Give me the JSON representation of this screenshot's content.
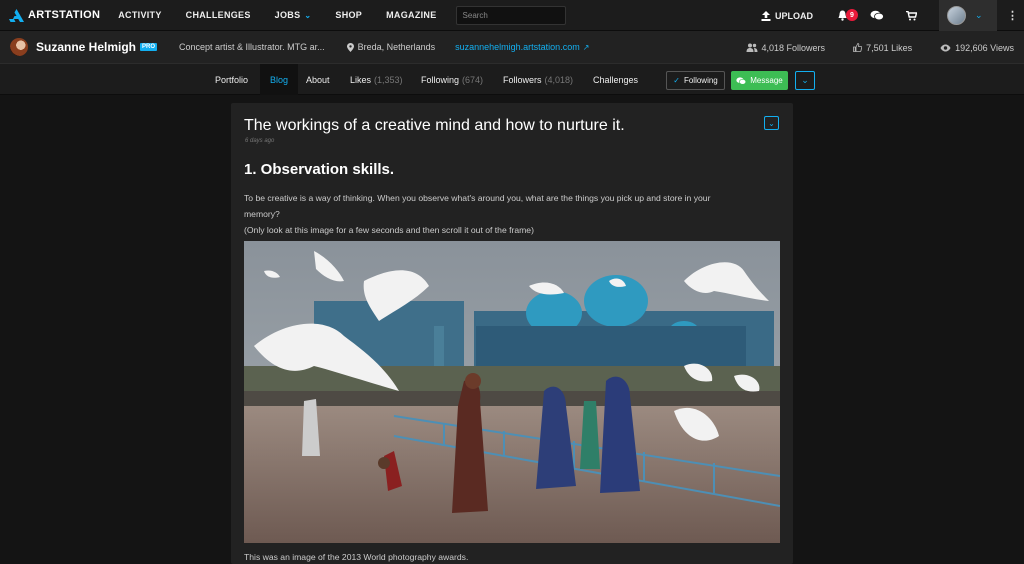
{
  "topnav": {
    "logo_text": "ARTSTATION",
    "items": [
      "ACTIVITY",
      "CHALLENGES",
      "JOBS",
      "SHOP",
      "MAGAZINE"
    ],
    "search_placeholder": "Search",
    "upload_label": "UPLOAD",
    "notification_count": "9"
  },
  "profile": {
    "name": "Suzanne Helmigh",
    "pro_badge": "PRO",
    "headline": "Concept artist & Illustrator. MTG ar...",
    "location": "Breda, Netherlands",
    "website": "suzannehelmigh.artstation.com",
    "followers": "4,018 Followers",
    "likes": "7,501 Likes",
    "views": "192,606 Views"
  },
  "subnav": {
    "tabs": [
      {
        "label": "Portfolio",
        "count": ""
      },
      {
        "label": "Blog",
        "count": ""
      },
      {
        "label": "About",
        "count": ""
      },
      {
        "label": "Likes",
        "count": "(1,353)"
      },
      {
        "label": "Following",
        "count": "(674)"
      },
      {
        "label": "Followers",
        "count": "(4,018)"
      },
      {
        "label": "Challenges",
        "count": ""
      }
    ],
    "following_btn": "Following",
    "message_btn": "Message"
  },
  "post": {
    "title": "The workings of a creative mind and how to nurture it.",
    "date": "6 days ago",
    "heading": "1. Observation skills.",
    "paragraph_lines": [
      "To be creative is a way of thinking. When you observe what's around you, what are the things you pick up and store in your",
      "memory?",
      "(Only look at this image for a few seconds and then scroll it out of the frame)"
    ],
    "caption": "This was an image of the 2013 World photography awards."
  },
  "colors": {
    "accent": "#13aff0",
    "message_green": "#3dbd54",
    "badge_red": "#e81a3b"
  }
}
